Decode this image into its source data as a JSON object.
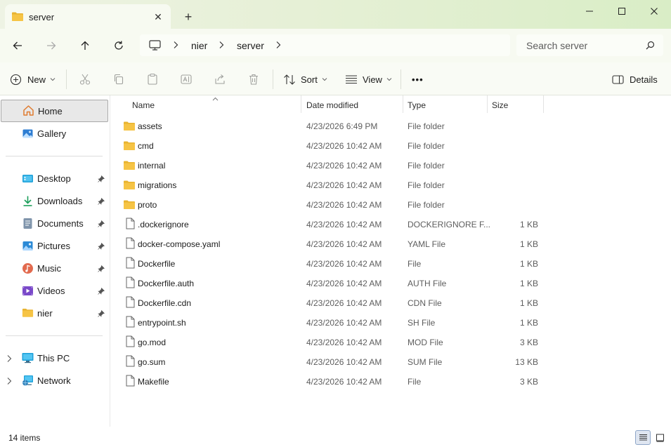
{
  "tab": {
    "title": "server",
    "close_symbol": "✕",
    "new_tab_symbol": "+"
  },
  "breadcrumb": [
    "nier",
    "server"
  ],
  "search": {
    "placeholder": "Search server"
  },
  "commands": {
    "new": "New",
    "sort": "Sort",
    "view": "View",
    "more": "•••",
    "details": "Details"
  },
  "sidebar": {
    "top": [
      {
        "label": "Home",
        "icon": "home-icon",
        "selected": true
      },
      {
        "label": "Gallery",
        "icon": "gallery-icon"
      }
    ],
    "quick": [
      {
        "label": "Desktop",
        "icon": "desktop-icon"
      },
      {
        "label": "Downloads",
        "icon": "downloads-icon"
      },
      {
        "label": "Documents",
        "icon": "documents-icon"
      },
      {
        "label": "Pictures",
        "icon": "pictures-icon"
      },
      {
        "label": "Music",
        "icon": "music-icon"
      },
      {
        "label": "Videos",
        "icon": "videos-icon"
      },
      {
        "label": "nier",
        "icon": "folder-icon"
      }
    ],
    "tree": [
      {
        "label": "This PC",
        "icon": "this-pc-icon"
      },
      {
        "label": "Network",
        "icon": "network-icon"
      }
    ]
  },
  "columns": {
    "name": "Name",
    "date": "Date modified",
    "type": "Type",
    "size": "Size"
  },
  "files": [
    {
      "name": "assets",
      "date": "4/23/2026 6:49 PM",
      "type": "File folder",
      "size": "",
      "kind": "folder"
    },
    {
      "name": "cmd",
      "date": "4/23/2026 10:42 AM",
      "type": "File folder",
      "size": "",
      "kind": "folder"
    },
    {
      "name": "internal",
      "date": "4/23/2026 10:42 AM",
      "type": "File folder",
      "size": "",
      "kind": "folder"
    },
    {
      "name": "migrations",
      "date": "4/23/2026 10:42 AM",
      "type": "File folder",
      "size": "",
      "kind": "folder"
    },
    {
      "name": "proto",
      "date": "4/23/2026 10:42 AM",
      "type": "File folder",
      "size": "",
      "kind": "folder"
    },
    {
      "name": ".dockerignore",
      "date": "4/23/2026 10:42 AM",
      "type": "DOCKERIGNORE F...",
      "size": "1 KB",
      "kind": "file"
    },
    {
      "name": "docker-compose.yaml",
      "date": "4/23/2026 10:42 AM",
      "type": "YAML File",
      "size": "1 KB",
      "kind": "file"
    },
    {
      "name": "Dockerfile",
      "date": "4/23/2026 10:42 AM",
      "type": "File",
      "size": "1 KB",
      "kind": "file"
    },
    {
      "name": "Dockerfile.auth",
      "date": "4/23/2026 10:42 AM",
      "type": "AUTH File",
      "size": "1 KB",
      "kind": "file"
    },
    {
      "name": "Dockerfile.cdn",
      "date": "4/23/2026 10:42 AM",
      "type": "CDN File",
      "size": "1 KB",
      "kind": "file"
    },
    {
      "name": "entrypoint.sh",
      "date": "4/23/2026 10:42 AM",
      "type": "SH File",
      "size": "1 KB",
      "kind": "file"
    },
    {
      "name": "go.mod",
      "date": "4/23/2026 10:42 AM",
      "type": "MOD File",
      "size": "3 KB",
      "kind": "file"
    },
    {
      "name": "go.sum",
      "date": "4/23/2026 10:42 AM",
      "type": "SUM File",
      "size": "13 KB",
      "kind": "file"
    },
    {
      "name": "Makefile",
      "date": "4/23/2026 10:42 AM",
      "type": "File",
      "size": "3 KB",
      "kind": "file"
    }
  ],
  "status": {
    "count": "14 items"
  },
  "colors": {
    "folder": "#f6c445",
    "accent": "#0067c0",
    "titlebar": "#e6f0d6"
  }
}
